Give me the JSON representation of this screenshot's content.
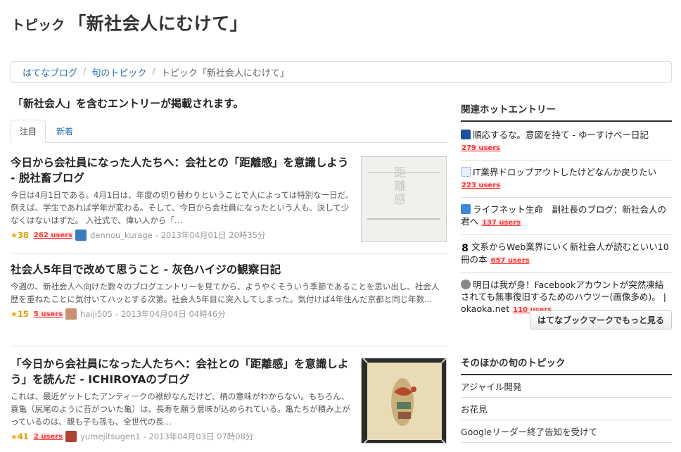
{
  "header": {
    "prefix": "トピック",
    "title": "「新社会人にむけて」"
  },
  "breadcrumb": {
    "items": [
      "はてなブログ",
      "旬のトピック"
    ],
    "current": "トピック「新社会人にむけて」"
  },
  "lead": "「新社会人」を含むエントリーが掲載されます。",
  "tabs": [
    {
      "label": "注目"
    },
    {
      "label": "新着"
    }
  ],
  "entries": [
    {
      "title": "今日から会社員になった人たちへ：会社との「距離感」を意識しよう - 脱社畜ブログ",
      "excerpt": "今日は4月1日である。4月1日は、年度の切り替わりということで人によっては特別な一日だ。例えば、学生であれば学年が変わる。そして、今日から会社員になったという人も、決して少なくはないはずだ。 入社式で、偉い人から「…",
      "stars": "38",
      "users": "262 users",
      "author": "dennou_kurage",
      "date": "- 2013年04月01日 20時35分",
      "thumb_text": "距離感"
    },
    {
      "title": "社会人5年目で改めて思うこと - 灰色ハイジの観察日記",
      "excerpt": "今週の、新社会人へ向けた数々のブログエントリーを見てから、ようやくそういう季節であることを思い出し、社会人歴を重ねたことに気付いてハッとする次第。社会人5年目に突入してしまった。気付けば4年住んだ京都と同じ年数…",
      "stars": "15",
      "users": "5 users",
      "author": "haiji505",
      "date": "- 2013年04月04日 04時46分"
    },
    {
      "title": "「今日から会社員になった人たちへ：会社との「距離感」を意識しよう」を読んだ - ICHIROYAのブログ",
      "excerpt": "これは、最近ゲットしたアンティークの袱紗なんだけど、柄の意味がわからない。もちろん、蓑亀（尻尾のように苔がついた亀）は、長寿を願う意味が込められている。亀たちが積み上がっているのは、親も子も孫も、全世代の長…",
      "stars": "41",
      "users": "2 users",
      "author": "yumejitsugen1",
      "date": "- 2013年04月03日 07時08分"
    }
  ],
  "sidebar": {
    "hot_title": "関連ホットエントリー",
    "hot": [
      {
        "icon": "yu-icon",
        "text": "順応するな。意図を持て - ゆーすけべー日記",
        "users": "279 users"
      },
      {
        "icon": "dots-icon",
        "text": "IT業界ドロップアウトしたけどなんか戻りたい",
        "users": "223 users"
      },
      {
        "icon": "feather-icon",
        "text": "ライフネット生命　副社長のブログ：新社会人の君へ",
        "users": "137 users"
      },
      {
        "icon": "eight-icon",
        "text": "文系からWeb業界にいく新社会人が読むといい10冊の本",
        "users": "657 users"
      },
      {
        "icon": "face-icon",
        "text": "明日は我が身！Facebookアカウントが突然凍結されても無事復旧するためのハウツー(画像多め)。 | okaoka.net",
        "users": "110 users"
      }
    ],
    "more_label": "はてなブックマークでもっと見る",
    "topics_title": "そのほかの旬のトピック",
    "topics": [
      "アジャイル開発",
      "お花見",
      "Googleリーダー終了告知を受けて"
    ]
  }
}
